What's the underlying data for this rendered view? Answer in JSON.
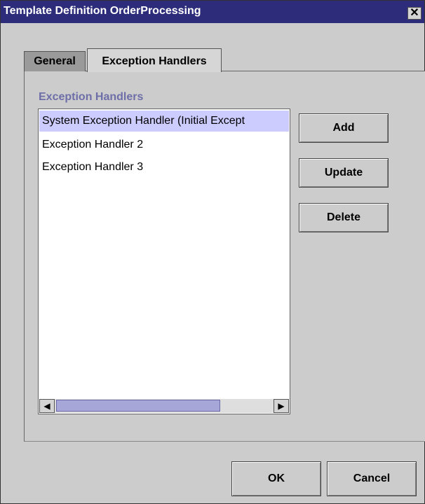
{
  "window": {
    "title": "Template Definition OrderProcessing",
    "close_glyph": "✕",
    "colors": {
      "titlebar": "#2c2c7a",
      "background": "#cccccc",
      "accent": "#6e6ea8",
      "selection": "#ccccff"
    }
  },
  "tabs": [
    {
      "label": "General",
      "active": false
    },
    {
      "label": "Exception Handlers",
      "active": true
    }
  ],
  "section": {
    "label": "Exception Handlers"
  },
  "list": {
    "items": [
      "System Exception Handler (Initial Except",
      "Exception Handler 2",
      "Exception Handler 3"
    ],
    "selected_index": 0
  },
  "scrollbar": {
    "left_icon": "arrow-left-icon",
    "right_icon": "arrow-right-icon"
  },
  "side_buttons": {
    "add": "Add",
    "update": "Update",
    "delete": "Delete"
  },
  "footer": {
    "ok": "OK",
    "cancel": "Cancel"
  }
}
